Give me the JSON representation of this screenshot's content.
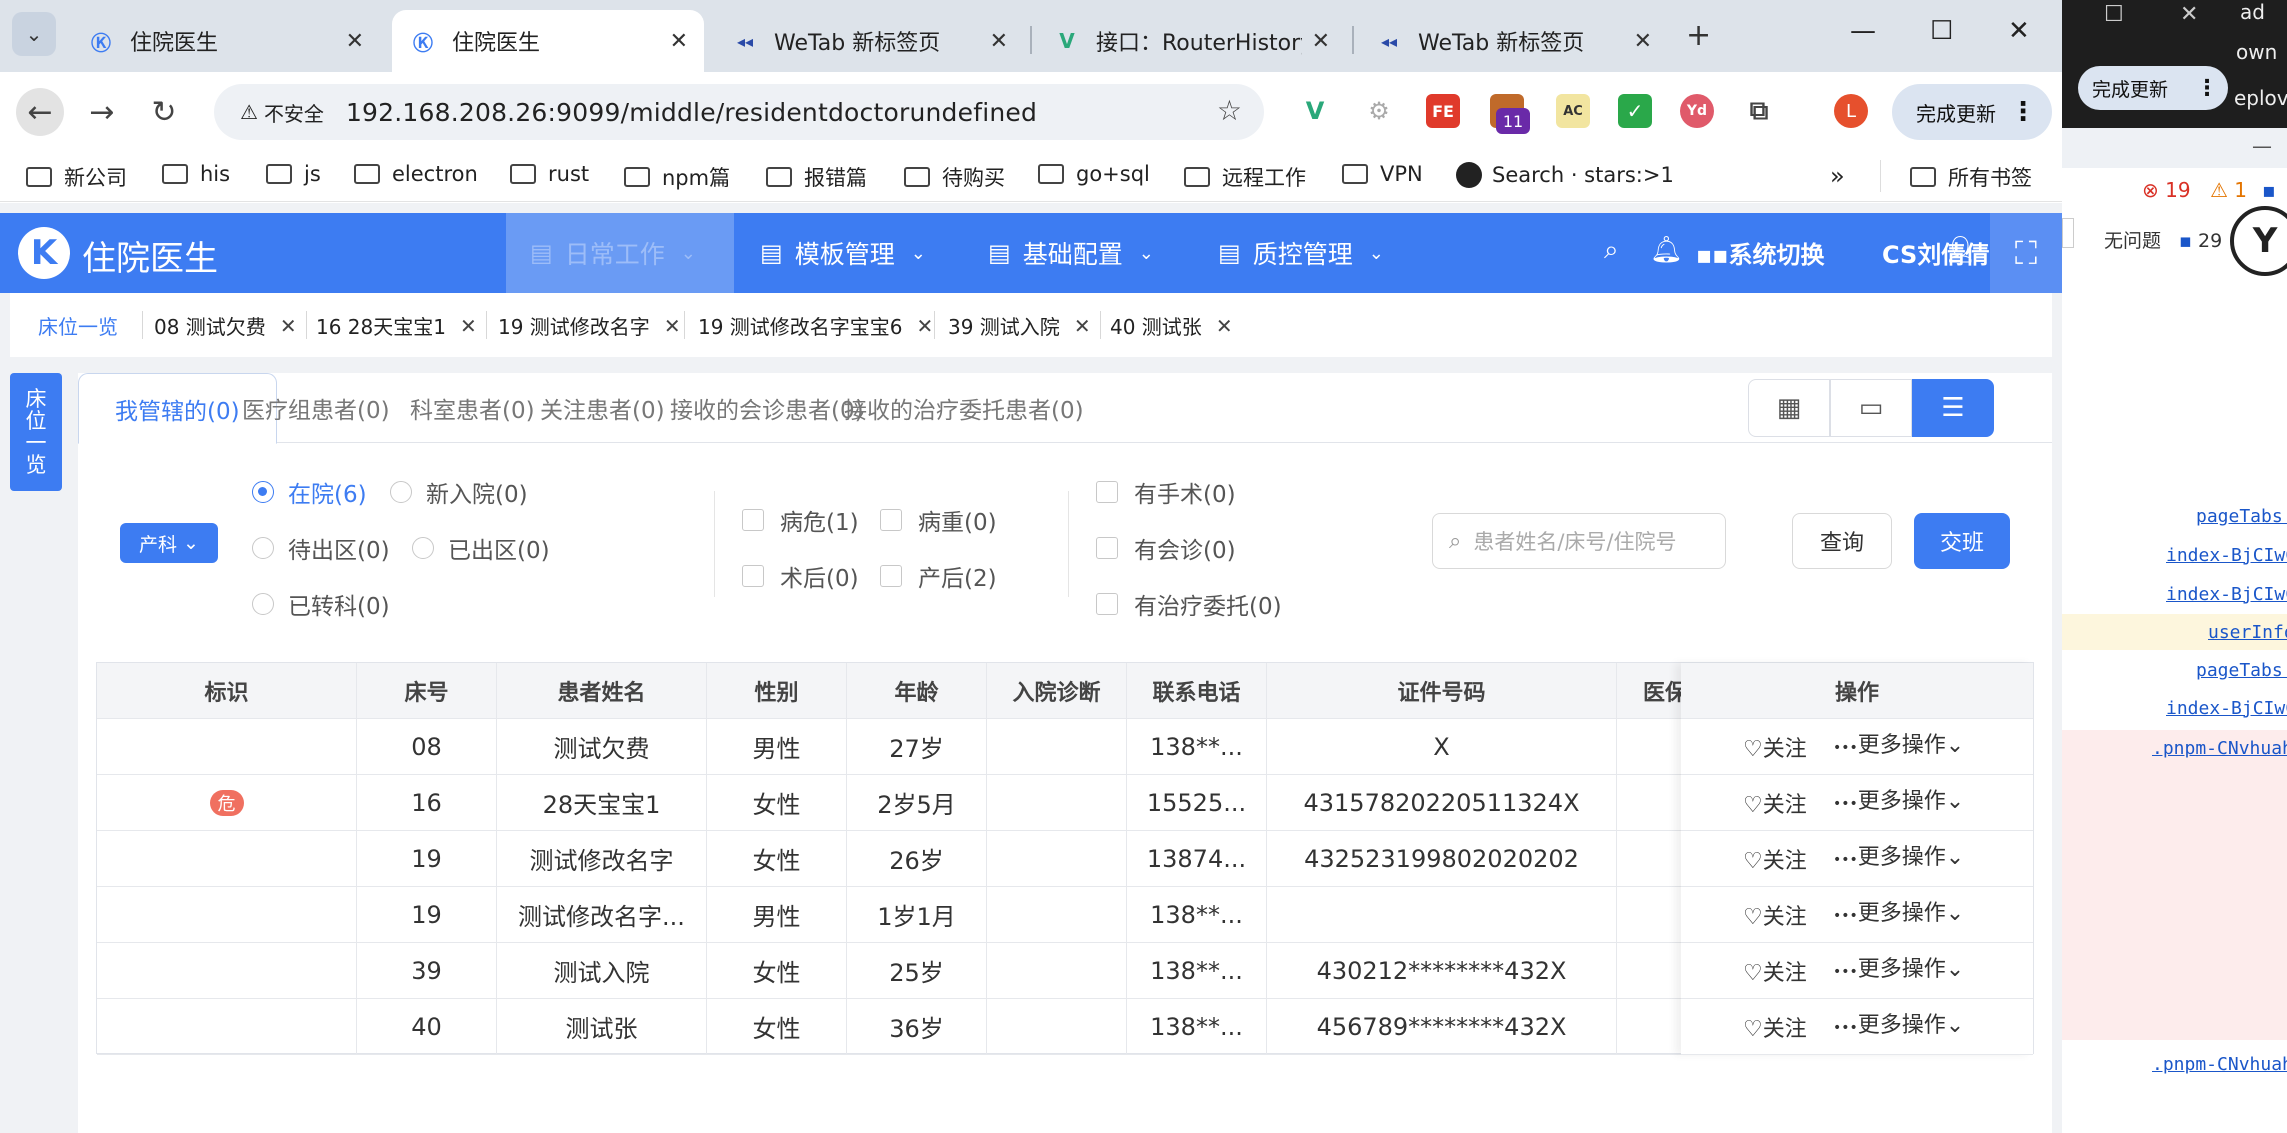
{
  "browser": {
    "tabs": [
      {
        "title": "住院医生",
        "active": false
      },
      {
        "title": "住院医生",
        "active": true
      },
      {
        "title": "WeTab 新标签页",
        "active": false
      },
      {
        "title": "接口：RouterHistory",
        "active": false
      },
      {
        "title": "WeTab 新标签页",
        "active": false
      }
    ],
    "insecure_label": "不安全",
    "url": "192.168.208.26:9099/middle/residentdoctorundefined",
    "extension_badge": "11",
    "profile_initial": "L",
    "update_label": "完成更新",
    "bookmarks": [
      "新公司",
      "his",
      "js",
      "electron",
      "rust",
      "npm篇",
      "报错篇",
      "待购买",
      "go+sql",
      "远程工作",
      "VPN",
      "Search · stars:>1"
    ],
    "all_bookmarks": "所有书签",
    "overflow": "»"
  },
  "app": {
    "title": "住院医生",
    "menus": [
      {
        "label": "日常工作",
        "active": true
      },
      {
        "label": "模板管理",
        "active": false
      },
      {
        "label": "基础配置",
        "active": false
      },
      {
        "label": "质控管理",
        "active": false
      }
    ],
    "system_switch": "系统切换",
    "user_name": "CS刘倩倩",
    "page_tabs": [
      {
        "label": "床位一览",
        "home": true
      },
      {
        "label": "08 测试欠费"
      },
      {
        "label": "16 28天宝宝1"
      },
      {
        "label": "19 测试修改名字"
      },
      {
        "label": "19 测试修改名字宝宝6"
      },
      {
        "label": "39 测试入院"
      },
      {
        "label": "40 测试张"
      }
    ],
    "side_tab": [
      "床",
      "位",
      "一",
      "览"
    ],
    "sub_tabs": [
      "我管辖的(0)",
      "医疗组患者(0)",
      "科室患者(0)",
      "关注患者(0)",
      "接收的会诊患者(0)",
      "接收的治疗委托患者(0)"
    ],
    "dept": "产科",
    "filters": {
      "status": [
        {
          "label": "在院(6)",
          "checked": true
        },
        {
          "label": "新入院(0)",
          "checked": false
        },
        {
          "label": "待出区(0)",
          "checked": false
        },
        {
          "label": "已出区(0)",
          "checked": false
        },
        {
          "label": "已转科(0)",
          "checked": false
        }
      ],
      "condition": [
        "病危(1)",
        "病重(0)",
        "术后(0)",
        "产后(2)"
      ],
      "extra": [
        "有手术(0)",
        "有会诊(0)",
        "有治疗委托(0)"
      ]
    },
    "search_placeholder": "患者姓名/床号/住院号",
    "query_label": "查询",
    "handover_label": "交班",
    "table": {
      "headers": [
        "标识",
        "床号",
        "患者姓名",
        "性别",
        "年龄",
        "入院诊断",
        "联系电话",
        "证件号码",
        "医保"
      ],
      "ops_header": "操作",
      "follow_label": "关注",
      "more_label": "更多操作",
      "rows": [
        {
          "tag": "",
          "bed": "08",
          "name": "测试欠费",
          "gender": "男性",
          "age": "27岁",
          "diagnosis": "",
          "phone": "138**...",
          "id": "X"
        },
        {
          "tag": "危",
          "bed": "16",
          "name": "28天宝宝1",
          "gender": "女性",
          "age": "2岁5月",
          "diagnosis": "",
          "phone": "15525...",
          "id": "43157820220511324X"
        },
        {
          "tag": "",
          "bed": "19",
          "name": "测试修改名字",
          "gender": "女性",
          "age": "26岁",
          "diagnosis": "",
          "phone": "13874...",
          "id": "432523199802020202"
        },
        {
          "tag": "",
          "bed": "19",
          "name": "测试修改名字...",
          "gender": "男性",
          "age": "1岁1月",
          "diagnosis": "",
          "phone": "138**...",
          "id": ""
        },
        {
          "tag": "",
          "bed": "39",
          "name": "测试入院",
          "gender": "女性",
          "age": "25岁",
          "diagnosis": "",
          "phone": "138**...",
          "id": "430212********432X"
        },
        {
          "tag": "",
          "bed": "40",
          "name": "测试张",
          "gender": "女性",
          "age": "36岁",
          "diagnosis": "",
          "phone": "138**...",
          "id": "456789********432X"
        }
      ]
    }
  },
  "devtools": {
    "update_label": "完成更新",
    "top_text": [
      "ad",
      "own",
      "eplov"
    ],
    "errors": "19",
    "warnings": "1",
    "no_issues": "无问题",
    "issue_count": "29",
    "sources": [
      "pageTabs.",
      "index-BjCIwC",
      "index-BjCIwC",
      "userInfo",
      "pageTabs.",
      "index-BjCIwC",
      ".pnpm-CNvhuah",
      ".pnpm-CNvhuah"
    ]
  },
  "colors": {
    "primary": "#3d7cf2",
    "danger": "#f07060",
    "tabstrip": "#dde3ea"
  }
}
